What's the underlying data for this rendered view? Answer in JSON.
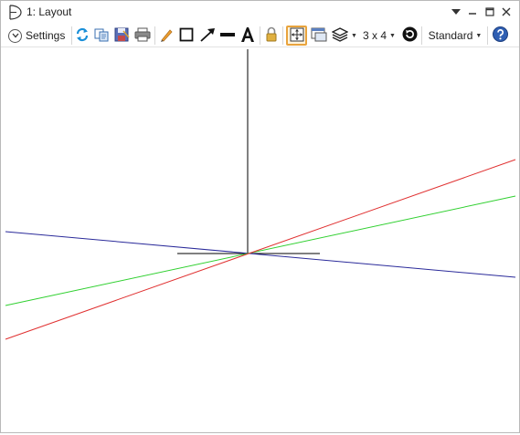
{
  "window": {
    "title": "1: Layout"
  },
  "toolbar": {
    "settings_label": "Settings",
    "layout_grid_label": "3 x 4",
    "view_mode_label": "Standard"
  },
  "colors": {
    "red_ray": "#e03030",
    "green_ray": "#30d030",
    "blue_ray": "#2a2a9a",
    "axis": "#000000",
    "accent_active": "#e8a33d"
  },
  "icons": [
    "layout-window-icon",
    "dropdown-arrow-icon",
    "restore-icon",
    "close-icon",
    "settings-chevron-icon",
    "refresh-icon",
    "copy-icon",
    "save-image-icon",
    "print-icon",
    "pencil-icon",
    "rectangle-icon",
    "arrow-icon",
    "line-icon",
    "text-icon",
    "lock-icon",
    "fit-to-window-icon",
    "window-icon",
    "layers-icon",
    "reset-icon",
    "help-icon"
  ]
}
